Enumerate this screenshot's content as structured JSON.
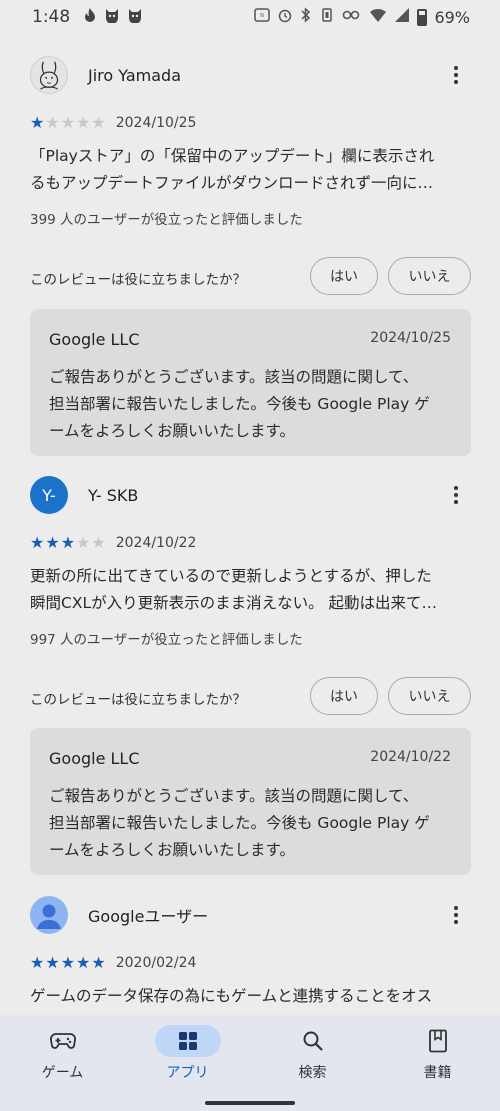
{
  "status_bar": {
    "time": "1:48",
    "battery": "69%",
    "battery_level": 0.69,
    "icons": [
      "flame-icon",
      "cat-icon",
      "cat-icon",
      "nfc-icon",
      "alarm-icon",
      "bluetooth-icon",
      "vibrate-icon",
      "key-icon",
      "wifi-icon",
      "signal-icon",
      "battery-icon"
    ]
  },
  "reviews": [
    {
      "reviewer": "Jiro Yamada",
      "avatar_type": "sketch",
      "rating": 1,
      "date": "2024/10/25",
      "body_lines": [
        "「Playストア」の「保留中のアップデート」欄に表示され",
        "るもアップデートファイルがダウンロードされず一向に…"
      ],
      "helpful_count": "399 人のユーザーが役立ったと評価しました",
      "helpful_question": "このレビューは役に立ちましたか？",
      "yes_label": "はい",
      "no_label": "いいえ",
      "reply": {
        "developer": "Google LLC",
        "date": "2024/10/25",
        "lines": [
          "ご報告ありがとうございます。該当の問題に関して、",
          "担当部署に報告いたしました。今後も Google Play ゲ",
          "ームをよろしくお願いいたします。"
        ]
      }
    },
    {
      "reviewer": "Y- SKB",
      "avatar_initial": "Y-",
      "rating": 3,
      "date": "2024/10/22",
      "body_lines": [
        "更新の所に出てきているので更新しようとするが、押した",
        "瞬間CXLが入り更新表示のまま消えない。 起動は出来て…"
      ],
      "helpful_count": "997 人のユーザーが役立ったと評価しました",
      "helpful_question": "このレビューは役に立ちましたか？",
      "yes_label": "はい",
      "no_label": "いいえ",
      "reply": {
        "developer": "Google LLC",
        "date": "2024/10/22",
        "lines": [
          "ご報告ありがとうございます。該当の問題に関して、",
          "担当部署に報告いたしました。今後も Google Play ゲ",
          "ームをよろしくお願いいたします。"
        ]
      }
    },
    {
      "reviewer": "Googleユーザー",
      "avatar_type": "person",
      "rating": 5,
      "date": "2020/02/24",
      "body_lines": [
        "ゲームのデータ保存の為にもゲームと連携することをオス"
      ]
    }
  ],
  "bottom_nav": {
    "items": [
      {
        "label": "ゲーム",
        "icon": "gamepad-icon",
        "active": false
      },
      {
        "label": "アプリ",
        "icon": "apps-grid-icon",
        "active": true
      },
      {
        "label": "検索",
        "icon": "search-icon",
        "active": false
      },
      {
        "label": "書籍",
        "icon": "book-icon",
        "active": false
      }
    ]
  },
  "colors": {
    "background": "#ececec",
    "accent": "#1a5fb4",
    "active_pill": "#bfd6f6",
    "reply_bg": "#dcdcdc",
    "nav_bg": "#e3e6ee"
  }
}
